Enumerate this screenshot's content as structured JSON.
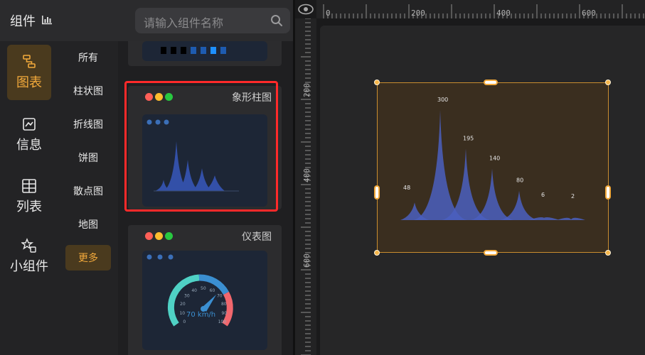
{
  "header": {
    "title": "组件",
    "title_icon": "bar-chart-icon",
    "search_placeholder": "请输入组件名称",
    "search_icon": "search-icon"
  },
  "nav_primary": [
    {
      "label": "图表",
      "icon": "chart-flow-icon",
      "active": true
    },
    {
      "label": "信息",
      "icon": "image-frame-icon",
      "active": false
    },
    {
      "label": "列表",
      "icon": "table-icon",
      "active": false
    },
    {
      "label": "小组件",
      "icon": "widget-star-icon",
      "active": false
    }
  ],
  "nav_secondary": [
    {
      "label": "所有",
      "active": false
    },
    {
      "label": "柱状图",
      "active": false
    },
    {
      "label": "折线图",
      "active": false
    },
    {
      "label": "饼图",
      "active": false
    },
    {
      "label": "散点图",
      "active": false
    },
    {
      "label": "地图",
      "active": false
    },
    {
      "label": "更多",
      "active": true
    }
  ],
  "cards": [
    {
      "title": "象形柱图",
      "highlighted": true
    },
    {
      "title": "仪表图",
      "highlighted": false
    }
  ],
  "gauge_preview": {
    "value_text": "70 km/h",
    "ticks": [
      "0",
      "10",
      "20",
      "30",
      "40",
      "50",
      "60",
      "70",
      "80",
      "90",
      "100"
    ]
  },
  "ruler": {
    "top_labels": [
      "0",
      "200",
      "400",
      "600"
    ],
    "left_labels": [
      "200",
      "400",
      "600"
    ]
  },
  "chart_data": {
    "type": "pictorial-bar",
    "values": [
      48,
      300,
      195,
      140,
      80,
      6,
      2
    ],
    "data_labels": [
      "48",
      "300",
      "195",
      "140",
      "80",
      "6",
      "2"
    ]
  },
  "colors": {
    "accent": "#f2a93b",
    "highlight_border": "#ff2a2a",
    "series": "#4b5fbf",
    "dot_red": "#ff5f57",
    "dot_yellow": "#febc2e",
    "dot_green": "#28c840"
  }
}
